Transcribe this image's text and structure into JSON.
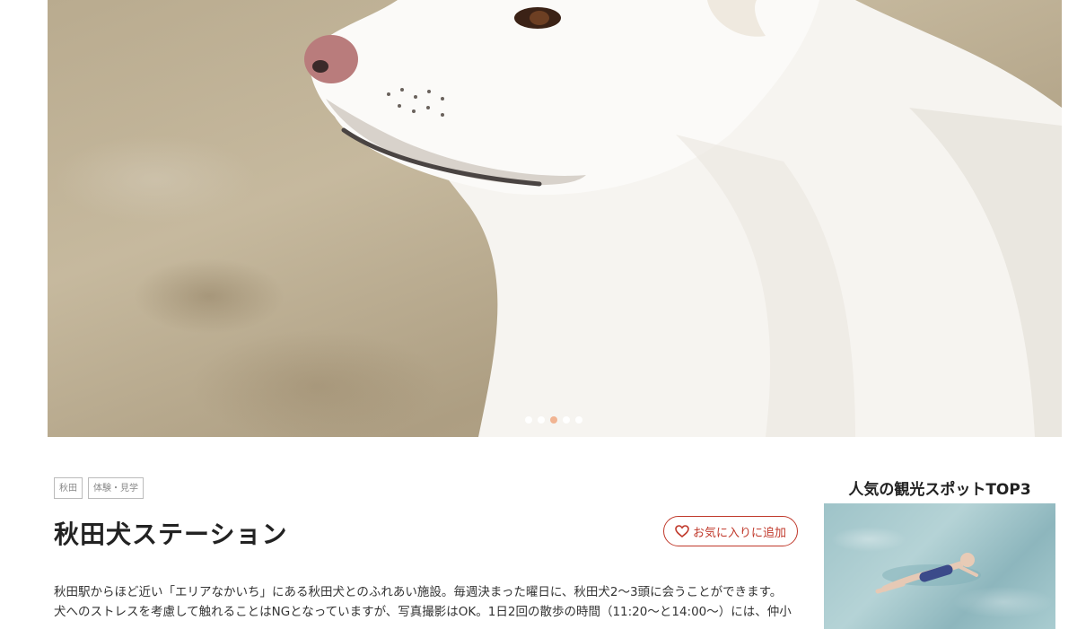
{
  "hero": {
    "image_alt": "白い秋田犬の横顔",
    "carousel": {
      "count": 5,
      "active_index": 2,
      "active_color": "#f0b08c"
    }
  },
  "spot": {
    "tags": [
      "秋田",
      "体験・見学"
    ],
    "title": "秋田犬ステーション",
    "favorite_label": "お気に入りに追加",
    "description_lines": [
      "秋田駅からほど近い「エリアなかいち」にある秋田犬とのふれあい施設。毎週決まった曜日に、秋田犬2〜3頭に会うことができます。",
      "犬へのストレスを考慮して触れることはNGとなっていますが、写真撮影はOK。1日2回の散歩の時間（11:20〜と14:00〜）には、仲小"
    ]
  },
  "sidebar": {
    "title": "人気の観光スポットTOP3",
    "image_alt": "海に浮かぶ人"
  },
  "colors": {
    "accent": "#c0392b"
  }
}
